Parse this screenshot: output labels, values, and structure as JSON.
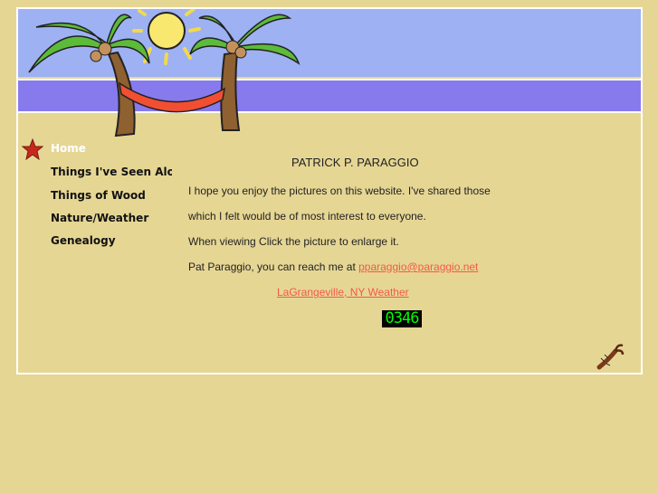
{
  "nav": [
    {
      "label": "Home"
    },
    {
      "label": "Things I've Seen Along the Way"
    },
    {
      "label": "Things of Wood"
    },
    {
      "label": "Nature/Weather"
    },
    {
      "label": "Genealogy"
    }
  ],
  "main": {
    "title": "PATRICK P. PARAGGIO",
    "p1": "I hope you enjoy the pictures on this website. I've shared those",
    "p2": "which I felt would be of most interest to everyone.",
    "p3": "When viewing Click the picture to enlarge it.",
    "p4": "Pat Paraggio, you can reach me at ",
    "email": "pparaggio@paraggio.net",
    "weather_link": "LaGrangeville, NY Weather",
    "counter": "0346"
  },
  "colors": {
    "background": "#e6d694",
    "sky": "#9db1f3",
    "sea": "#877aed",
    "link": "#f25a4a"
  }
}
